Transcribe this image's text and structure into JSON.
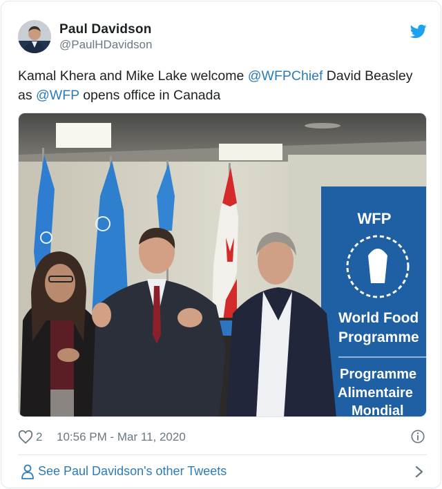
{
  "tweet": {
    "author_name": "Paul Davidson",
    "author_handle": "@PaulHDavidson",
    "text_part1": "Kamal Khera and Mike Lake welcome ",
    "mention1": "@WFPChief",
    "text_part2": " David Beasley as ",
    "mention2": "@WFP",
    "text_part3": " opens office in Canada",
    "like_count": "2",
    "timestamp": "10:56 PM - Mar 11, 2020",
    "see_more_label": "See Paul Davidson's other Tweets"
  },
  "banner": {
    "acronym": "WFP",
    "line1": "World Food",
    "line2": "Programme",
    "line3": "Programme",
    "line4": "Alimentaire",
    "line5": "Mondial"
  },
  "icons": {
    "platform": "twitter-bird-icon",
    "like": "heart-icon",
    "info": "info-icon",
    "profile": "person-icon",
    "more": "chevron-right-icon"
  },
  "colors": {
    "link": "#2b7bb9",
    "muted": "#697882",
    "brand": "#1da1f2",
    "wfp_blue": "#1f5fa3"
  }
}
